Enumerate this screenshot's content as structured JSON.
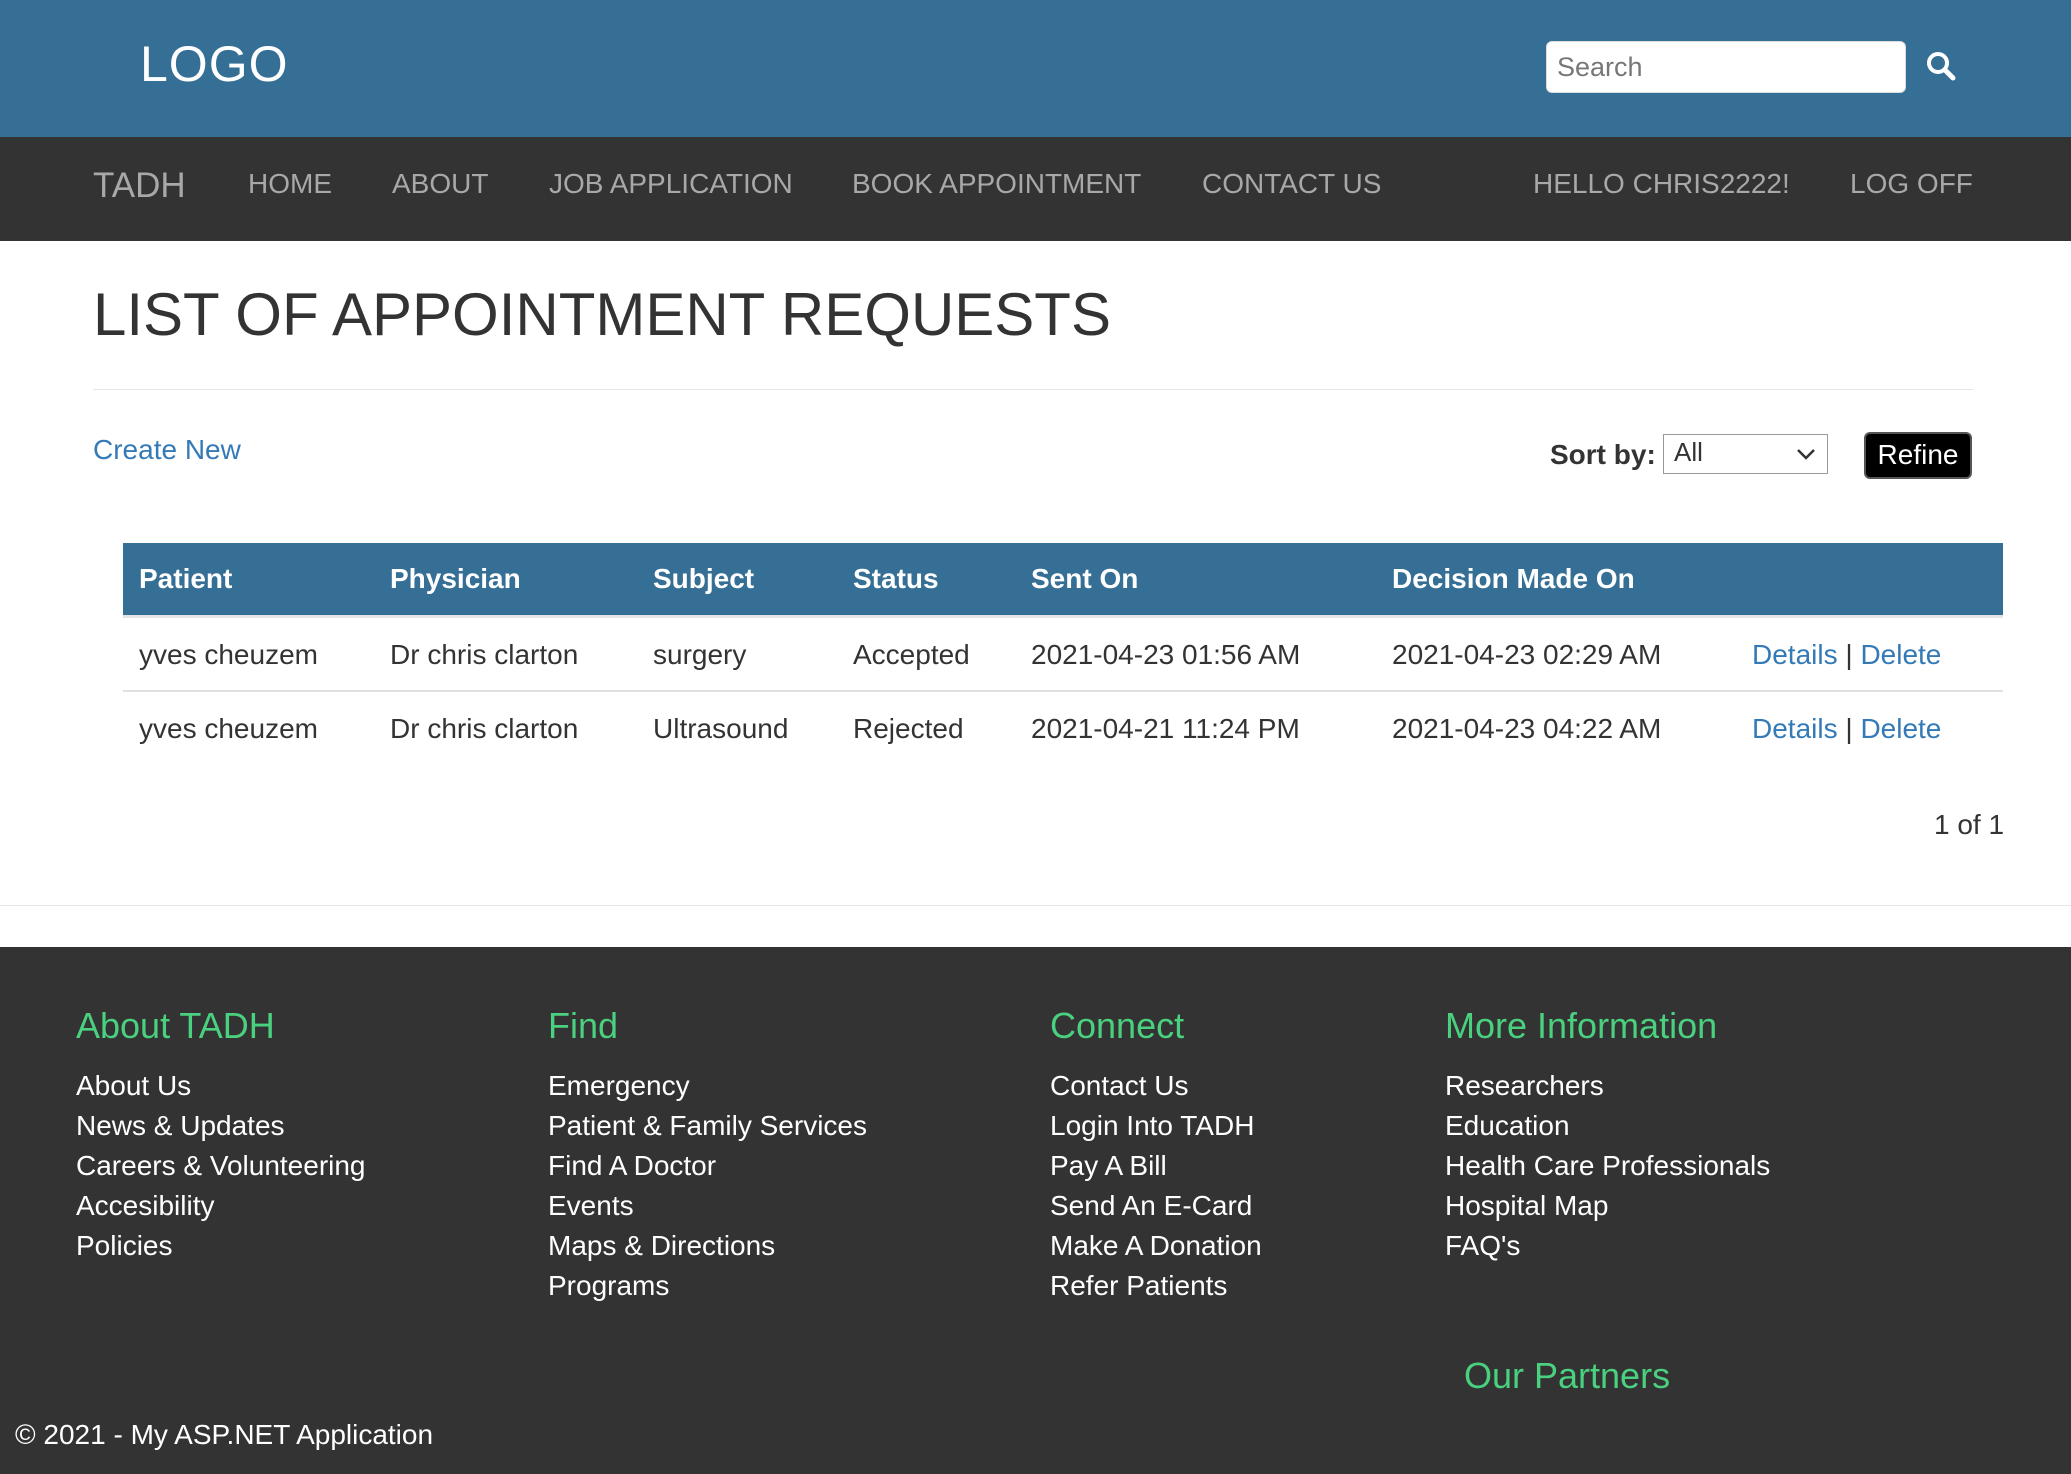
{
  "header": {
    "logo": "LOGO",
    "search_placeholder": "Search"
  },
  "nav": {
    "brand": "TADH",
    "items": [
      "HOME",
      "ABOUT",
      "JOB APPLICATION",
      "BOOK APPOINTMENT",
      "CONTACT US"
    ],
    "greeting": "HELLO CHRIS2222!",
    "logoff": "LOG OFF"
  },
  "main": {
    "title": "LIST OF APPOINTMENT REQUESTS",
    "create_new": "Create New",
    "sort_label": "Sort by:",
    "sort_value": "All",
    "refine": "Refine",
    "table": {
      "headers": [
        "Patient",
        "Physician",
        "Subject",
        "Status",
        "Sent On",
        "Decision Made On"
      ],
      "rows": [
        {
          "patient": "yves cheuzem",
          "physician": "Dr chris clarton",
          "subject": "surgery",
          "status": "Accepted",
          "sent_on": "2021-04-23 01:56 AM",
          "decision": "2021-04-23 02:29 AM"
        },
        {
          "patient": "yves cheuzem",
          "physician": "Dr chris clarton",
          "subject": "Ultrasound",
          "status": "Rejected",
          "sent_on": "2021-04-21 11:24 PM",
          "decision": "2021-04-23 04:22 AM"
        }
      ],
      "details": "Details",
      "separator": "|",
      "delete": "Delete"
    },
    "pager": "1 of 1"
  },
  "footer": {
    "columns": [
      {
        "heading": "About TADH",
        "links": [
          "About Us",
          "News & Updates",
          "Careers & Volunteering",
          "Accesibility",
          "Policies"
        ]
      },
      {
        "heading": "Find",
        "links": [
          "Emergency",
          "Patient & Family Services",
          "Find A Doctor",
          "Events",
          "Maps & Directions",
          "Programs"
        ]
      },
      {
        "heading": "Connect",
        "links": [
          "Contact Us",
          "Login Into TADH",
          "Pay A Bill",
          "Send An E-Card",
          "Make A Donation",
          "Refer Patients"
        ]
      },
      {
        "heading": "More Information",
        "links": [
          "Researchers",
          "Education",
          "Health Care Professionals",
          "Hospital Map",
          "FAQ's"
        ]
      }
    ],
    "partners": "Our Partners",
    "copyright": "© 2021 - My ASP.NET Application"
  },
  "colors": {
    "banner": "#356f95",
    "navbar": "#333333",
    "footer_heading": "#4ad17f",
    "link": "#337ab7"
  },
  "icons": {
    "search": "search-icon",
    "dropdown": "chevron-down-icon"
  }
}
